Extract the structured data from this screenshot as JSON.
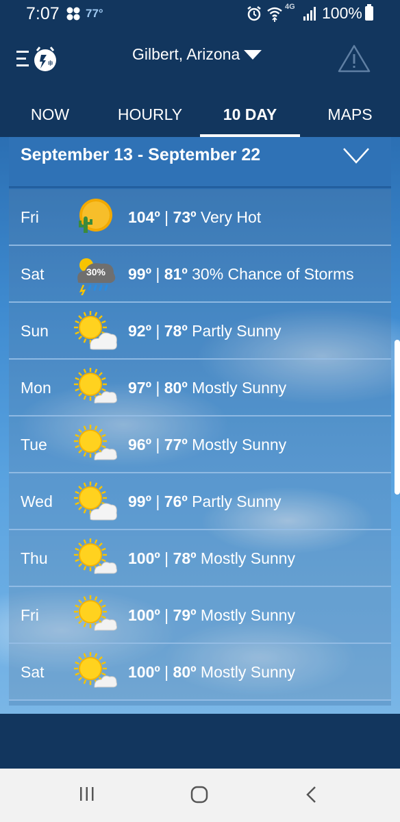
{
  "status_bar": {
    "time": "7:07",
    "temperature": "77°",
    "network": "4G",
    "battery": "100%"
  },
  "header": {
    "location": "Gilbert, Arizona"
  },
  "tabs": [
    {
      "label": "NOW",
      "active": false
    },
    {
      "label": "HOURLY",
      "active": false
    },
    {
      "label": "10 DAY",
      "active": true
    },
    {
      "label": "MAPS",
      "active": false
    }
  ],
  "forecast": {
    "range_title": "September 13 - September 22",
    "days": [
      {
        "day": "Fri",
        "high": "104º",
        "low": "73º",
        "condition": "Very Hot",
        "icon": "hot-sun-cactus-icon"
      },
      {
        "day": "Sat",
        "high": "99º",
        "low": "81º",
        "condition": "30% Chance of Storms",
        "icon": "storm-cloud-icon",
        "badge": "30%"
      },
      {
        "day": "Sun",
        "high": "92º",
        "low": "78º",
        "condition": "Partly Sunny",
        "icon": "partly-sunny-icon"
      },
      {
        "day": "Mon",
        "high": "97º",
        "low": "80º",
        "condition": "Mostly Sunny",
        "icon": "mostly-sunny-icon"
      },
      {
        "day": "Tue",
        "high": "96º",
        "low": "77º",
        "condition": "Mostly Sunny",
        "icon": "mostly-sunny-icon"
      },
      {
        "day": "Wed",
        "high": "99º",
        "low": "76º",
        "condition": "Partly Sunny",
        "icon": "partly-sunny-icon"
      },
      {
        "day": "Thu",
        "high": "100º",
        "low": "78º",
        "condition": "Mostly Sunny",
        "icon": "mostly-sunny-icon"
      },
      {
        "day": "Fri",
        "high": "100º",
        "low": "79º",
        "condition": "Mostly Sunny",
        "icon": "mostly-sunny-icon"
      },
      {
        "day": "Sat",
        "high": "100º",
        "low": "80º",
        "condition": "Mostly Sunny",
        "icon": "mostly-sunny-icon"
      }
    ]
  },
  "colors": {
    "header_bg": "#12365e",
    "range_header_bg": "#2f72b6",
    "text": "#ffffff",
    "status_temp": "#9ec8f0"
  }
}
